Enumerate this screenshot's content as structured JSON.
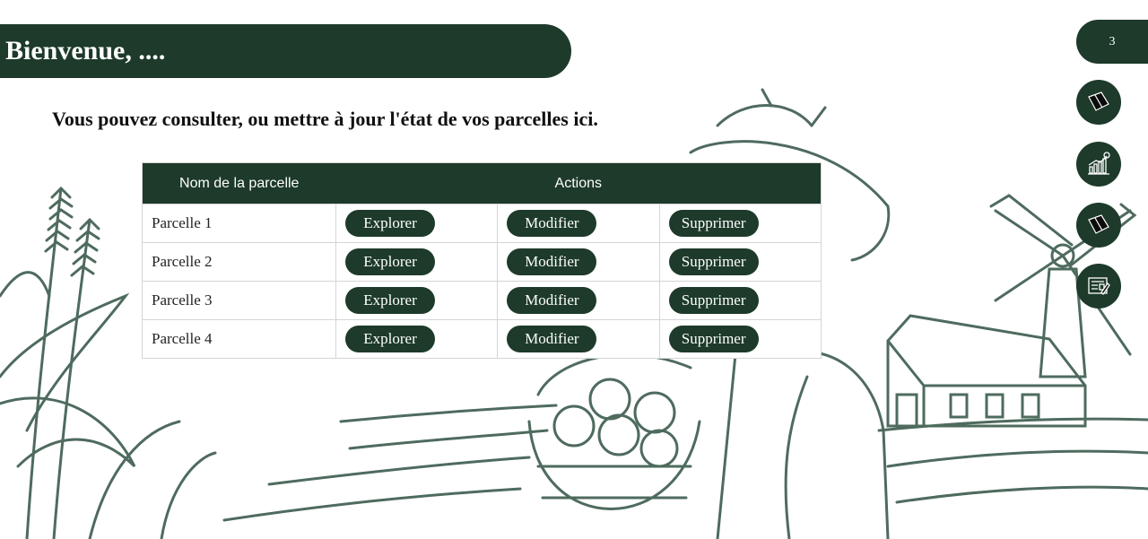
{
  "header": {
    "title": "Bienvenue, ...."
  },
  "intro": {
    "text": "Vous pouvez consulter, ou mettre à jour l'état de vos parcelles ici."
  },
  "table": {
    "headers": {
      "name": "Nom de la parcelle",
      "actions": "Actions"
    },
    "rows": [
      {
        "name": "Parcelle 1",
        "explore": "Explorer",
        "edit": "Modifier",
        "delete": "Supprimer"
      },
      {
        "name": "Parcelle 2",
        "explore": "Explorer",
        "edit": "Modifier",
        "delete": "Supprimer"
      },
      {
        "name": "Parcelle 3",
        "explore": "Explorer",
        "edit": "Modifier",
        "delete": "Supprimer"
      },
      {
        "name": "Parcelle 4",
        "explore": "Explorer",
        "edit": "Modifier",
        "delete": "Supprimer"
      }
    ]
  },
  "sidebar": {
    "page_number": "3",
    "items": [
      {
        "icon": "map-icon"
      },
      {
        "icon": "growth-chart-icon"
      },
      {
        "icon": "map-icon"
      },
      {
        "icon": "report-icon"
      }
    ]
  },
  "colors": {
    "accent": "#1d3a2a",
    "illustration": "#4e6b5e"
  }
}
